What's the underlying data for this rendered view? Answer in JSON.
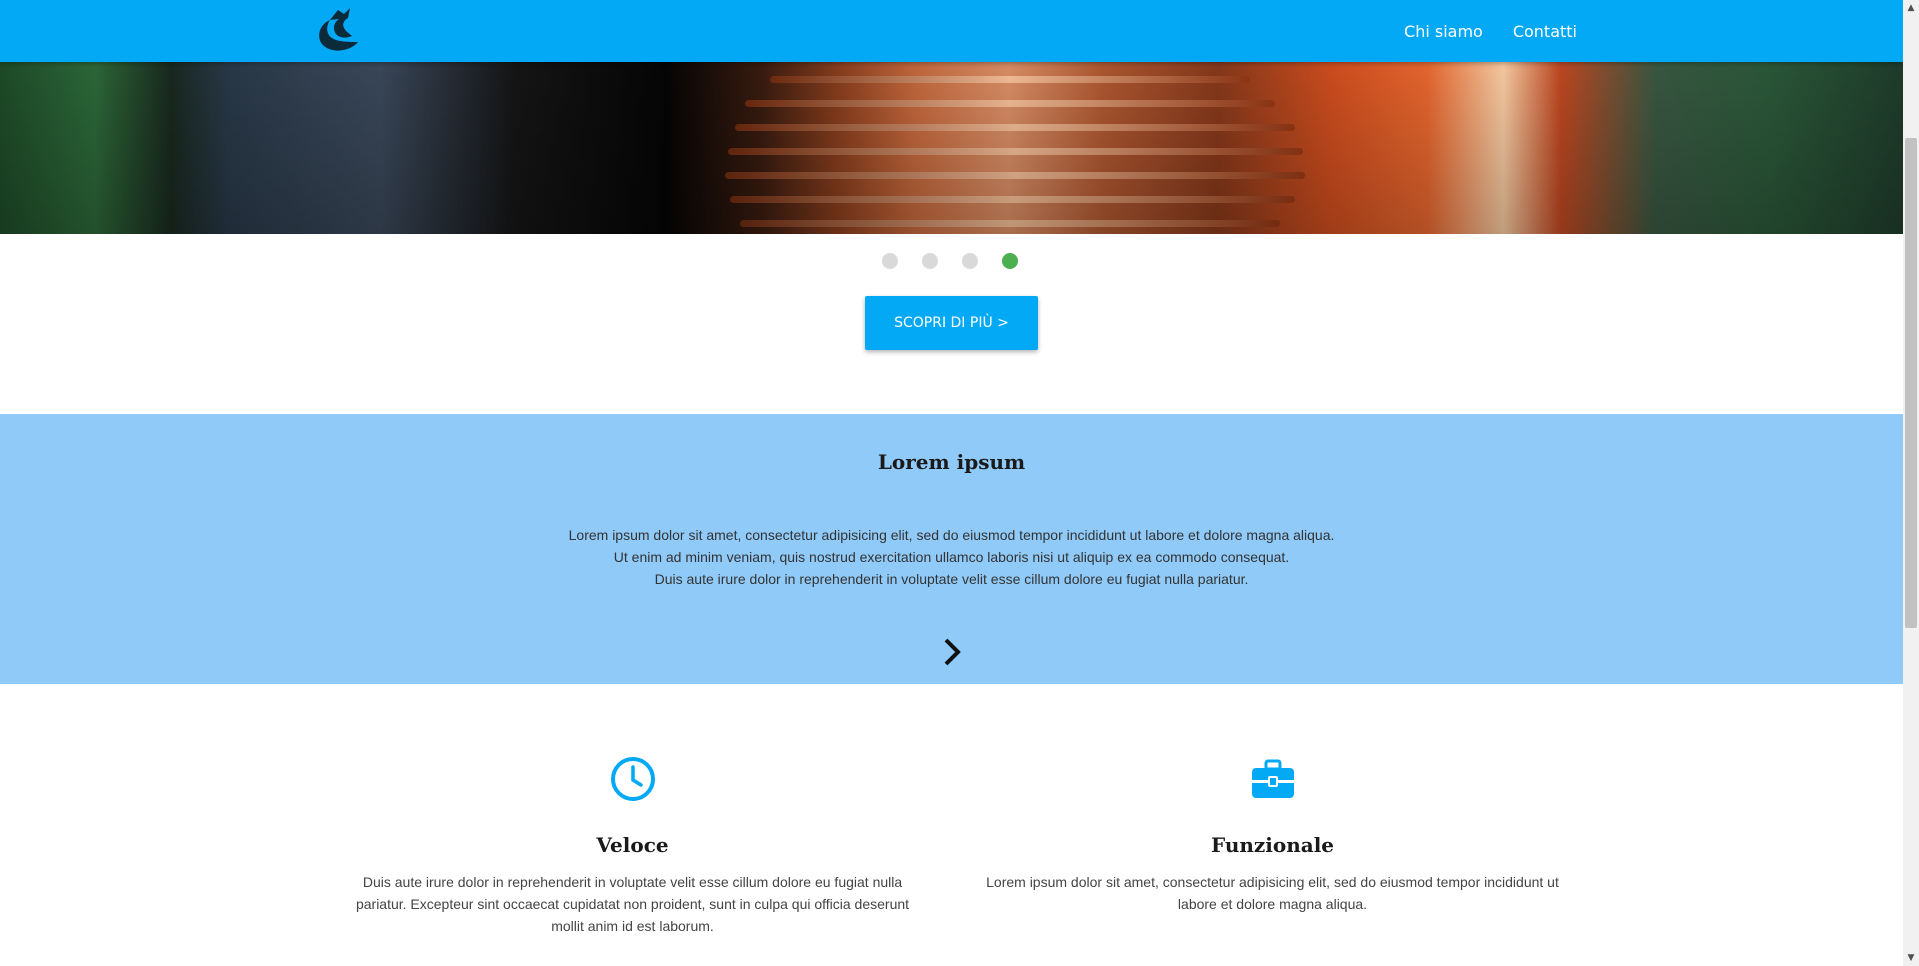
{
  "navbar": {
    "logo_name": "wave-logo",
    "links": [
      {
        "label": "Chi siamo"
      },
      {
        "label": "Contatti"
      }
    ]
  },
  "carousel": {
    "slide_count": 4,
    "active_index": 3
  },
  "cta": {
    "label": "SCOPRI DI PIÙ >"
  },
  "band": {
    "title": "Lorem ipsum",
    "lines": [
      "Lorem ipsum dolor sit amet, consectetur adipisicing elit, sed do eiusmod tempor incididunt ut labore et dolore magna aliqua.",
      "Ut enim ad minim veniam, quis nostrud exercitation ullamco laboris nisi ut aliquip ex ea commodo consequat.",
      "Duis aute irure dolor in reprehenderit in voluptate velit esse cillum dolore eu fugiat nulla pariatur."
    ]
  },
  "features": [
    {
      "icon": "clock-icon",
      "title": "Veloce",
      "text": "Duis aute irure dolor in reprehenderit in voluptate velit esse cillum dolore eu fugiat nulla pariatur. Excepteur sint occaecat cupidatat non proident, sunt in culpa qui officia deserunt mollit anim id est laborum."
    },
    {
      "icon": "briefcase-icon",
      "title": "Funzionale",
      "text": "Lorem ipsum dolor sit amet, consectetur adipisicing elit, sed do eiusmod tempor incididunt ut labore et dolore magna aliqua."
    }
  ],
  "colors": {
    "primary": "#03a9f4",
    "band": "#90caf9",
    "dot_active": "#4caf50",
    "dot_inactive": "#d9d9d9"
  }
}
